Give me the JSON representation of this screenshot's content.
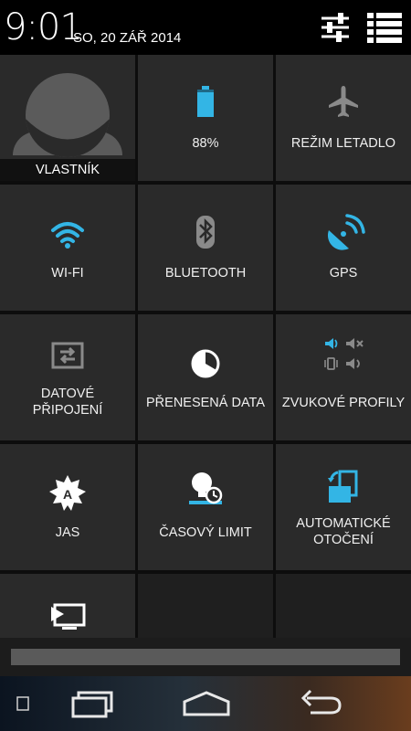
{
  "status": {
    "time": "9:01",
    "date": "SO, 20 ZÁŘ 2014"
  },
  "header_buttons": {
    "settings_icon": "settings-sliders-icon",
    "notifications_icon": "notification-list-icon"
  },
  "tiles": {
    "owner": "VLASTNÍK",
    "battery": "88%",
    "airplane": "REŽIM LETADLO",
    "wifi": "WI-FI",
    "bluetooth": "BLUETOOTH",
    "gps": "GPS",
    "data_line1": "DATOVÉ",
    "data_line2": "PŘIPOJENÍ",
    "data_usage": "PŘENESENÁ DATA",
    "sound_profiles": "ZVUKOVÉ PROFILY",
    "brightness": "JAS",
    "timeout": "ČASOVÝ LIMIT",
    "rotation_line1": "AUTOMATICKÉ",
    "rotation_line2": "OTOČENÍ"
  },
  "colors": {
    "accent": "#33b5e5",
    "tile_bg": "#2a2a2a",
    "icon_gray": "#8a8a8a"
  },
  "battery_level": 0.88
}
